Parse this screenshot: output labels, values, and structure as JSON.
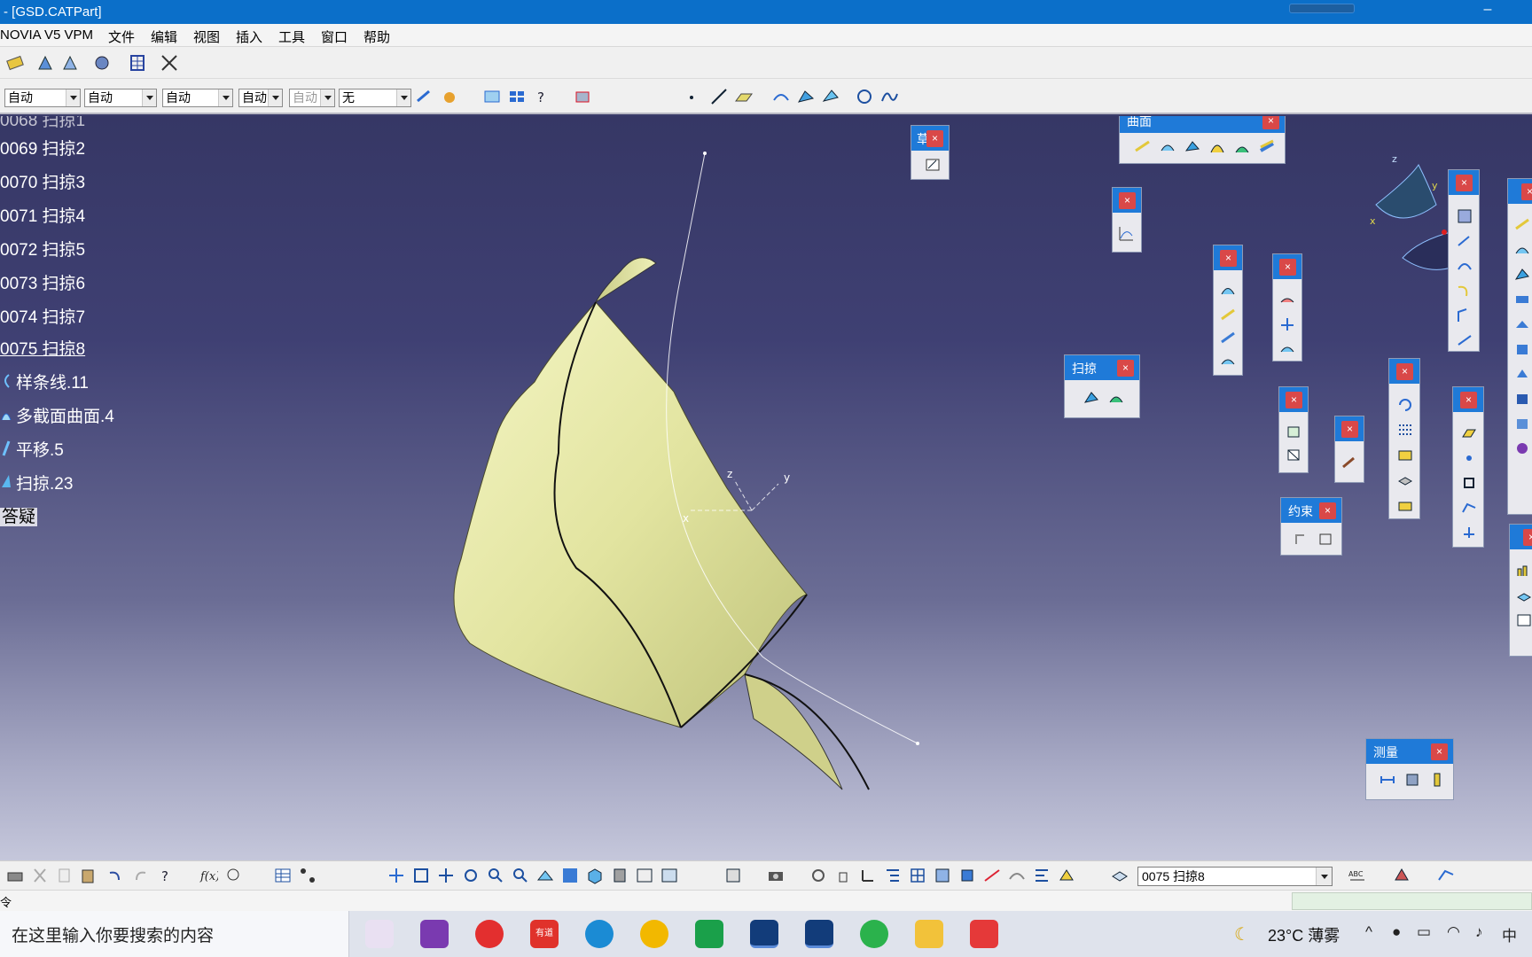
{
  "window": {
    "title": "- [GSD.CATPart]"
  },
  "menu": [
    "NOVIA V5 VPM",
    "文件",
    "编辑",
    "视图",
    "插入",
    "工具",
    "窗口",
    "帮助"
  ],
  "toolbar2": {
    "combos": [
      "自动",
      "自动",
      "自动",
      "自动",
      "自动",
      "无"
    ],
    "disabled_combo": "自动"
  },
  "tree": {
    "partial_top": "0068 扫掠1",
    "items": [
      {
        "label": "0069 扫掠2",
        "icon": "none"
      },
      {
        "label": "0070 扫掠3",
        "icon": "none"
      },
      {
        "label": "0071 扫掠4",
        "icon": "none"
      },
      {
        "label": "0072 扫掠5",
        "icon": "none"
      },
      {
        "label": "0073 扫掠6",
        "icon": "none"
      },
      {
        "label": "0074 扫掠7",
        "icon": "none"
      },
      {
        "label": "0075 扫掠8",
        "icon": "none",
        "selected": true
      },
      {
        "label": "样条线.11",
        "icon": "spline-icon"
      },
      {
        "label": "多截面曲面.4",
        "icon": "multisection-surface-icon"
      },
      {
        "label": "平移.5",
        "icon": "translate-icon"
      },
      {
        "label": "扫掠.23",
        "icon": "sweep-icon"
      }
    ],
    "last_label": "答疑"
  },
  "palettes": {
    "surface": "曲面",
    "sweep": "扫掠",
    "constraint": "约束",
    "measure": "测量",
    "sketch_partial": "草",
    "close_label": "×"
  },
  "axis_labels": {
    "x": "x",
    "y": "y",
    "z": "z"
  },
  "bottom": {
    "current_feature": "0075 扫掠8",
    "abc_label": "ABC"
  },
  "status": {
    "command_label": "令"
  },
  "taskbar": {
    "search_placeholder": "在这里输入你要搜索的内容",
    "weather": "23°C 薄雾",
    "ime": "中",
    "apps": [
      "app-icon",
      "onenote-icon",
      "music-icon",
      "youdao-icon",
      "edge-icon",
      "chrome-icon",
      "pycharm-icon",
      "catia-icon",
      "catia-icon",
      "wechat-icon",
      "explorer-icon",
      "xmind-icon"
    ],
    "youdao_label": "有道"
  },
  "colors": {
    "surface": "#e4e6a8",
    "titlebar": "#0b6fc9",
    "palette_caption": "#1f7ad8",
    "close": "#d94848"
  }
}
